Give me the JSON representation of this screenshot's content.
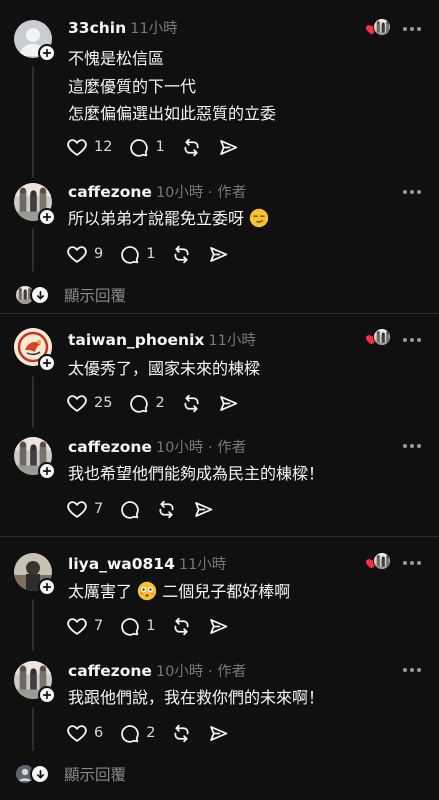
{
  "ui_text": {
    "dot_sep": "·"
  },
  "comments": [
    {
      "username": "33chin",
      "time": "11小時",
      "lines": [
        "不愧是松信區",
        "這麼優質的下一代",
        "怎麼偏偏選出如此惡質的立委"
      ],
      "likes": "12",
      "replies": "1"
    },
    {
      "username": "caffezone",
      "time": "10小時",
      "author_badge": "作者",
      "text": "所以弟弟才說罷免立委呀",
      "likes": "9",
      "replies": "1"
    },
    {
      "username": "taiwan_phoenix",
      "time": "11小時",
      "text": "太優秀了，國家未來的棟樑",
      "likes": "25",
      "replies": "2"
    },
    {
      "username": "caffezone",
      "time": "10小時",
      "author_badge": "作者",
      "text": "我也希望他們能夠成為民主的棟樑！",
      "likes": "7",
      "replies": ""
    },
    {
      "username": "liya_wa0814",
      "time": "11小時",
      "text_before": "太厲害了",
      "text_after": "二個兒子都好棒啊",
      "likes": "7",
      "replies": "1"
    },
    {
      "username": "caffezone",
      "time": "10小時",
      "author_badge": "作者",
      "text": "我跟他們說，我在救你們的未來啊！",
      "likes": "6",
      "replies": "2"
    }
  ],
  "show_replies_label": "顯示回覆",
  "colors": {
    "background": "#101010",
    "text": "#f3f5f7",
    "muted": "#777777",
    "heart": "#ff3040"
  }
}
